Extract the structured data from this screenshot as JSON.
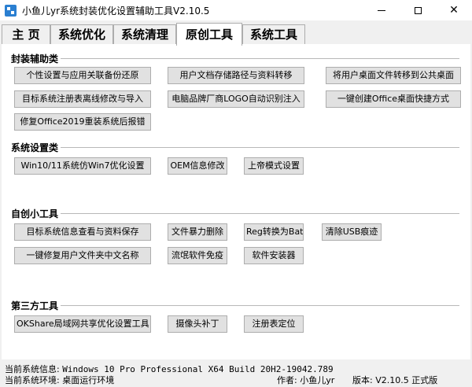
{
  "window": {
    "title": "小鱼儿yr系统封装优化设置辅助工具V2.10.5",
    "controls": {
      "minimize": "",
      "maximize": "",
      "close": "✕"
    }
  },
  "tabs": [
    {
      "label": "主 页",
      "active": false
    },
    {
      "label": "系统优化",
      "active": false
    },
    {
      "label": "系统清理",
      "active": false
    },
    {
      "label": "原创工具",
      "active": true
    },
    {
      "label": "系统工具",
      "active": false
    }
  ],
  "groups": {
    "packaging": {
      "title": "封装辅助类",
      "buttons": [
        "个性设置与应用关联备份还原",
        "用户文档存储路径与资料转移",
        "将用户桌面文件转移到公共桌面",
        "目标系统注册表离线修改与导入",
        "电脑品牌厂商LOGO自动识别注入",
        "一键创建Office桌面快捷方式",
        "修复Office2019重装系统后报错"
      ]
    },
    "system_settings": {
      "title": "系统设置类",
      "buttons": [
        "Win10/11系统仿Win7优化设置",
        "OEM信息修改",
        "上帝模式设置"
      ]
    },
    "custom_tools": {
      "title": "自创小工具",
      "buttons": [
        "目标系统信息查看与资料保存",
        "文件暴力删除",
        "Reg转换为Bat",
        "清除USB痕迹",
        "一键修复用户文件夹中文名称",
        "流氓软件免疫",
        "软件安装器"
      ]
    },
    "third_party": {
      "title": "第三方工具",
      "buttons": [
        "OKShare局域网共享优化设置工具",
        "摄像头补丁",
        "注册表定位"
      ]
    }
  },
  "status": {
    "system_info_label": "当前系统信息:",
    "system_info_value": "Windows 10 Pro Professional X64 Build 20H2-19042.789",
    "env_label": "当前系统环境:",
    "env_value": "桌面运行环境",
    "author_label": "作者:",
    "author_value": "小鱼儿yr",
    "version_label": "版本:",
    "version_value": "V2.10.5 正式版"
  }
}
